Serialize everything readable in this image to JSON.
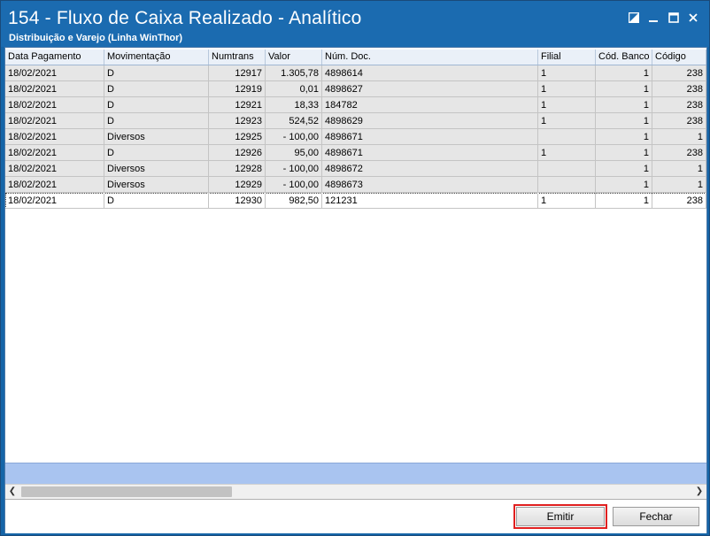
{
  "window": {
    "title": "154 - Fluxo de Caixa Realizado - Analítico",
    "subtitle": "Distribuição e Varejo (Linha WinThor)"
  },
  "grid": {
    "columns": [
      "Data Pagamento",
      "Movimentação",
      "Numtrans",
      "Valor",
      "Núm. Doc.",
      "Filial",
      "Cód. Banco",
      "Código"
    ],
    "rows": [
      {
        "data": "18/02/2021",
        "mov": "D",
        "numtrans": "12917",
        "valor": "1.305,78",
        "doc": "4898614",
        "filial": "1",
        "banco": "1",
        "codigo": "238"
      },
      {
        "data": "18/02/2021",
        "mov": "D",
        "numtrans": "12919",
        "valor": "0,01",
        "doc": "4898627",
        "filial": "1",
        "banco": "1",
        "codigo": "238"
      },
      {
        "data": "18/02/2021",
        "mov": "D",
        "numtrans": "12921",
        "valor": "18,33",
        "doc": "184782",
        "filial": "1",
        "banco": "1",
        "codigo": "238"
      },
      {
        "data": "18/02/2021",
        "mov": "D",
        "numtrans": "12923",
        "valor": "524,52",
        "doc": "4898629",
        "filial": "1",
        "banco": "1",
        "codigo": "238"
      },
      {
        "data": "18/02/2021",
        "mov": "Diversos",
        "numtrans": "12925",
        "valor": "- 100,00",
        "doc": "4898671",
        "filial": "",
        "banco": "1",
        "codigo": "1"
      },
      {
        "data": "18/02/2021",
        "mov": "D",
        "numtrans": "12926",
        "valor": "95,00",
        "doc": "4898671",
        "filial": "1",
        "banco": "1",
        "codigo": "238"
      },
      {
        "data": "18/02/2021",
        "mov": "Diversos",
        "numtrans": "12928",
        "valor": "- 100,00",
        "doc": "4898672",
        "filial": "",
        "banco": "1",
        "codigo": "1"
      },
      {
        "data": "18/02/2021",
        "mov": "Diversos",
        "numtrans": "12929",
        "valor": "- 100,00",
        "doc": "4898673",
        "filial": "",
        "banco": "1",
        "codigo": "1"
      },
      {
        "data": "18/02/2021",
        "mov": "D",
        "numtrans": "12930",
        "valor": "982,50",
        "doc": "121231",
        "filial": "1",
        "banco": "1",
        "codigo": "238"
      }
    ]
  },
  "buttons": {
    "emitir": "Emitir",
    "fechar": "Fechar"
  },
  "icons": {
    "restore": "restore-icon",
    "minimize": "minimize-icon",
    "maximize": "maximize-icon",
    "close": "close-icon"
  },
  "colors": {
    "titlebar": "#1b6bb0",
    "highlight": "#e02020"
  }
}
